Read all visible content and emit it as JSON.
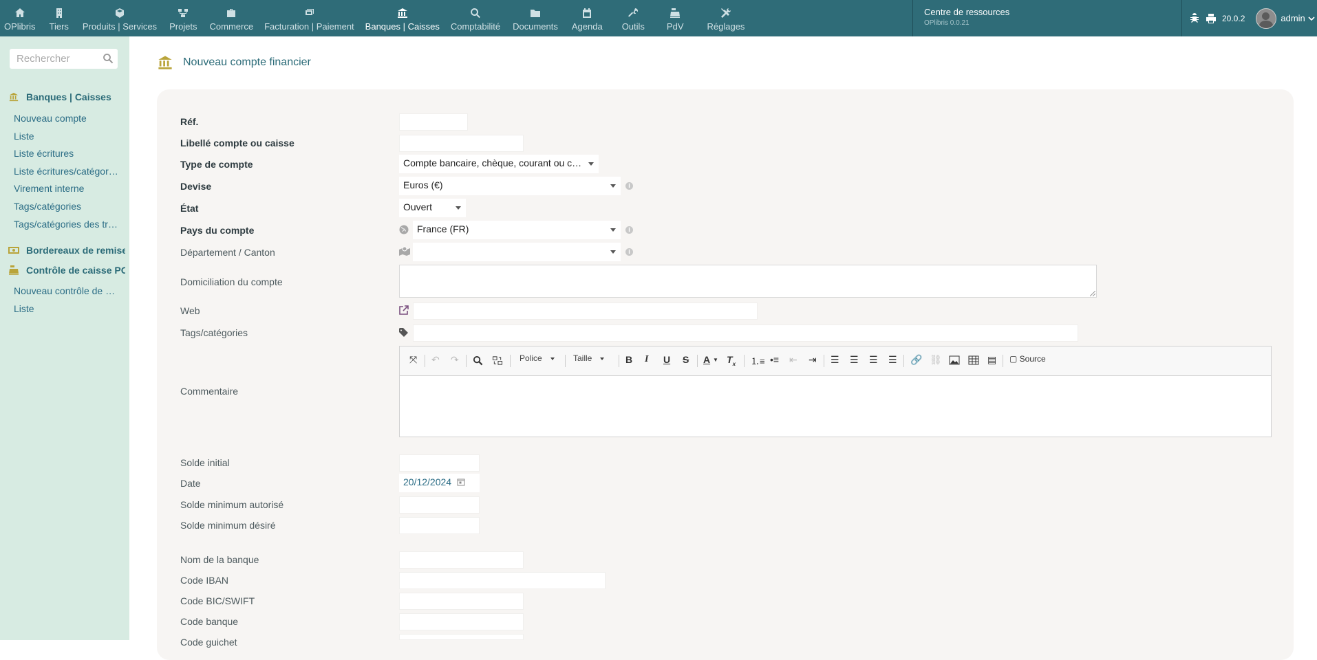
{
  "topmenu": {
    "items": [
      {
        "label": "OPlibris",
        "icon": "home-icon"
      },
      {
        "label": "Tiers",
        "icon": "building-icon"
      },
      {
        "label": "Produits | Services",
        "icon": "cube-icon"
      },
      {
        "label": "Projets",
        "icon": "project-icon"
      },
      {
        "label": "Commerce",
        "icon": "suitcase-icon"
      },
      {
        "label": "Facturation | Paiement",
        "icon": "money-icon"
      },
      {
        "label": "Banques | Caisses",
        "icon": "bank-icon",
        "active": true
      },
      {
        "label": "Comptabilité",
        "icon": "search-dollar-icon"
      },
      {
        "label": "Documents",
        "icon": "folder-icon"
      },
      {
        "label": "Agenda",
        "icon": "calendar-icon"
      },
      {
        "label": "Outils",
        "icon": "wrench-icon"
      },
      {
        "label": "PdV",
        "icon": "cash-register-icon"
      },
      {
        "label": "Réglages",
        "icon": "tools-icon"
      }
    ]
  },
  "resources": {
    "title": "Centre de ressources",
    "version": "OPlibris 0.0.21"
  },
  "topright": {
    "version": "20.0.2",
    "user": "admin"
  },
  "sidebar": {
    "search_placeholder": "Rechercher",
    "section1": {
      "title": "Banques | Caisses",
      "items": [
        "Nouveau compte",
        "Liste",
        "Liste écritures",
        "Liste écritures/catégories",
        "Virement interne",
        "Tags/catégories",
        "Tags/catégories des transactions"
      ]
    },
    "section2": {
      "title": "Bordereaux de remise"
    },
    "section3": {
      "title": "Contrôle de caisse POS",
      "items": [
        "Nouveau contrôle de caisse",
        "Liste"
      ]
    }
  },
  "page": {
    "title": "Nouveau compte financier"
  },
  "form": {
    "ref": "Réf.",
    "label": "Libellé compte ou caisse",
    "type": "Type de compte",
    "type_value": "Compte bancaire, chèque, courant ou carte",
    "currency": "Devise",
    "currency_value": "Euros (€)",
    "state": "État",
    "state_value": "Ouvert",
    "country": "Pays du compte",
    "country_value": "France (FR)",
    "department": "Département / Canton",
    "domiciliation": "Domiciliation du compte",
    "web": "Web",
    "tags": "Tags/catégories",
    "comment": "Commentaire",
    "initial_balance": "Solde initial",
    "date": "Date",
    "date_value": "20/12/2024",
    "min_allowed": "Solde minimum autorisé",
    "min_desired": "Solde minimum désiré",
    "bank_name": "Nom de la banque",
    "iban": "Code IBAN",
    "bic": "Code BIC/SWIFT",
    "bank_code": "Code banque",
    "desk_code": "Code guichet"
  },
  "editor": {
    "font": "Police",
    "size": "Taille",
    "source": "Source"
  }
}
